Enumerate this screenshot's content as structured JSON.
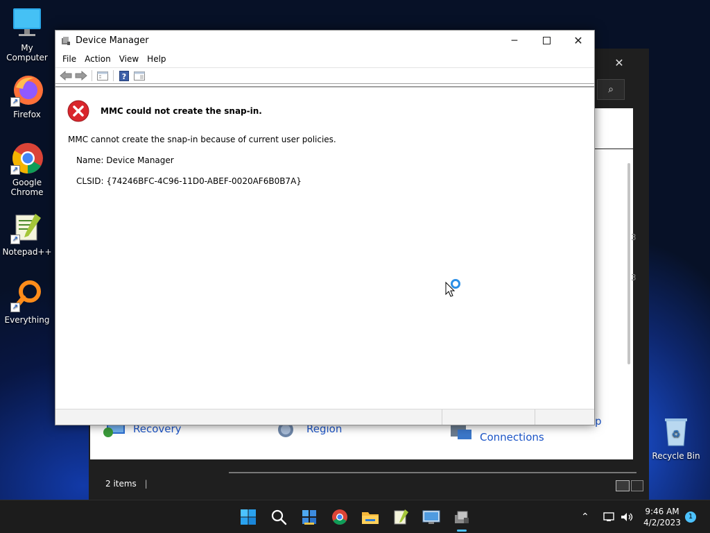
{
  "desktop": {
    "icons": [
      {
        "label": "My Computer"
      },
      {
        "label": "Firefox"
      },
      {
        "label": "Google\nChrome"
      },
      {
        "label": "Notepad++"
      },
      {
        "label": "Everything"
      },
      {
        "label": "Recycle Bin"
      }
    ]
  },
  "background_window": {
    "items": [
      "Recovery",
      "Region",
      "Connections"
    ],
    "status": "2 items",
    "side_numbers": [
      "3",
      "3"
    ]
  },
  "window": {
    "title": "Device Manager",
    "menus": [
      "File",
      "Action",
      "View",
      "Help"
    ],
    "error_title": "MMC could not create the snap-in.",
    "message": "MMC cannot create the snap-in because of current user policies.",
    "name_line": "Name: Device Manager",
    "clsid_line": "CLSID: {74246BFC-4C96-11D0-ABEF-0020AF6B0B7A}"
  },
  "taskbar": {
    "time": "9:46 AM",
    "date": "4/2/2023",
    "notification_count": "1"
  },
  "colors": {
    "accent": "#4cc2ff",
    "error_red": "#d9262c",
    "link_blue": "#1c55c8"
  }
}
